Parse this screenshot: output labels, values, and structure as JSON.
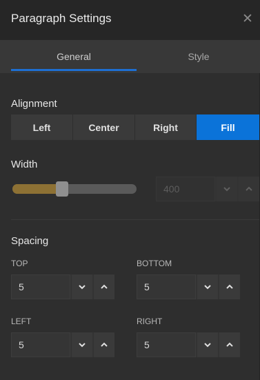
{
  "title": "Paragraph Settings",
  "close_icon": "close-icon",
  "tabs": [
    {
      "label": "General",
      "active": true
    },
    {
      "label": "Style",
      "active": false
    }
  ],
  "accent_color": "#0b73d9",
  "alignment": {
    "heading": "Alignment",
    "options": [
      "Left",
      "Center",
      "Right",
      "Fill"
    ],
    "selected": "Fill"
  },
  "width": {
    "heading": "Width",
    "slider_fraction": 0.4,
    "value": "400",
    "disabled": true
  },
  "spacing": {
    "heading": "Spacing",
    "top": {
      "label": "TOP",
      "value": "5"
    },
    "bottom": {
      "label": "BOTTOM",
      "value": "5"
    },
    "left": {
      "label": "LEFT",
      "value": "5"
    },
    "right": {
      "label": "RIGHT",
      "value": "5"
    }
  }
}
